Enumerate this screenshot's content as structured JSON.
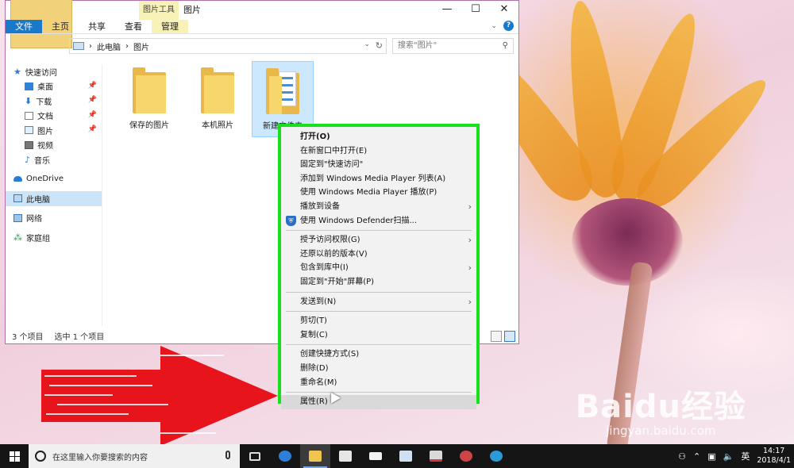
{
  "window": {
    "tool_tab_header": "图片工具",
    "title": "图片",
    "ribbon_tabs": [
      "文件",
      "主页",
      "共享",
      "查看",
      "管理"
    ],
    "address_path": [
      "此电脑",
      "图片"
    ],
    "search_placeholder": "搜索\"图片\"",
    "controls": {
      "minimize": "—",
      "maximize": "☐",
      "close": "✕"
    }
  },
  "sidebar": {
    "quick_access": "快速访问",
    "quick_items": [
      {
        "label": "桌面",
        "icon": "desktop-icon",
        "pinned": true
      },
      {
        "label": "下载",
        "icon": "download-icon",
        "pinned": true
      },
      {
        "label": "文档",
        "icon": "document-icon",
        "pinned": true
      },
      {
        "label": "图片",
        "icon": "pictures-icon",
        "pinned": true
      },
      {
        "label": "视频",
        "icon": "video-icon",
        "pinned": false
      },
      {
        "label": "音乐",
        "icon": "music-icon",
        "pinned": false
      }
    ],
    "onedrive": "OneDrive",
    "this_pc": "此电脑",
    "network": "网络",
    "homegroup": "家庭组"
  },
  "folders": [
    {
      "name": "保存的图片",
      "selected": false
    },
    {
      "name": "本机照片",
      "selected": false
    },
    {
      "name": "新建文件夹",
      "selected": true
    }
  ],
  "status": {
    "count": "3 个项目",
    "selected": "选中 1 个项目"
  },
  "context_menu": {
    "groups": [
      [
        {
          "label": "打开(O)",
          "bold": true
        },
        {
          "label": "在新窗口中打开(E)"
        },
        {
          "label": "固定到\"快速访问\""
        },
        {
          "label": "添加到 Windows Media Player 列表(A)"
        },
        {
          "label": "使用 Windows Media Player 播放(P)"
        },
        {
          "label": "播放到设备",
          "submenu": true
        },
        {
          "label": "使用 Windows Defender扫描...",
          "icon": "windows-defender-icon"
        }
      ],
      [
        {
          "label": "授予访问权限(G)",
          "submenu": true
        },
        {
          "label": "还原以前的版本(V)"
        },
        {
          "label": "包含到库中(I)",
          "submenu": true
        },
        {
          "label": "固定到\"开始\"屏幕(P)"
        }
      ],
      [
        {
          "label": "发送到(N)",
          "submenu": true
        }
      ],
      [
        {
          "label": "剪切(T)"
        },
        {
          "label": "复制(C)"
        }
      ],
      [
        {
          "label": "创建快捷方式(S)"
        },
        {
          "label": "删除(D)"
        },
        {
          "label": "重命名(M)"
        }
      ],
      [
        {
          "label": "属性(R)",
          "hover": true
        }
      ]
    ],
    "highlight_color": "#19e01d"
  },
  "annotation": {
    "arrow_color": "#e8141c"
  },
  "watermark": {
    "logo": "Baidu经验",
    "url": "jingyan.baidu.com"
  },
  "taskbar": {
    "search_placeholder": "在这里输入你要搜索的内容",
    "apps": [
      "task-view-icon",
      "edge-icon",
      "file-explorer-icon",
      "store-icon",
      "mail-icon",
      "notepad-icon",
      "photos-icon",
      "paint-icon",
      "browser-icon"
    ],
    "active_app": "file-explorer-icon",
    "ime": "英",
    "time": "14:17",
    "date": "2018/4/1"
  }
}
